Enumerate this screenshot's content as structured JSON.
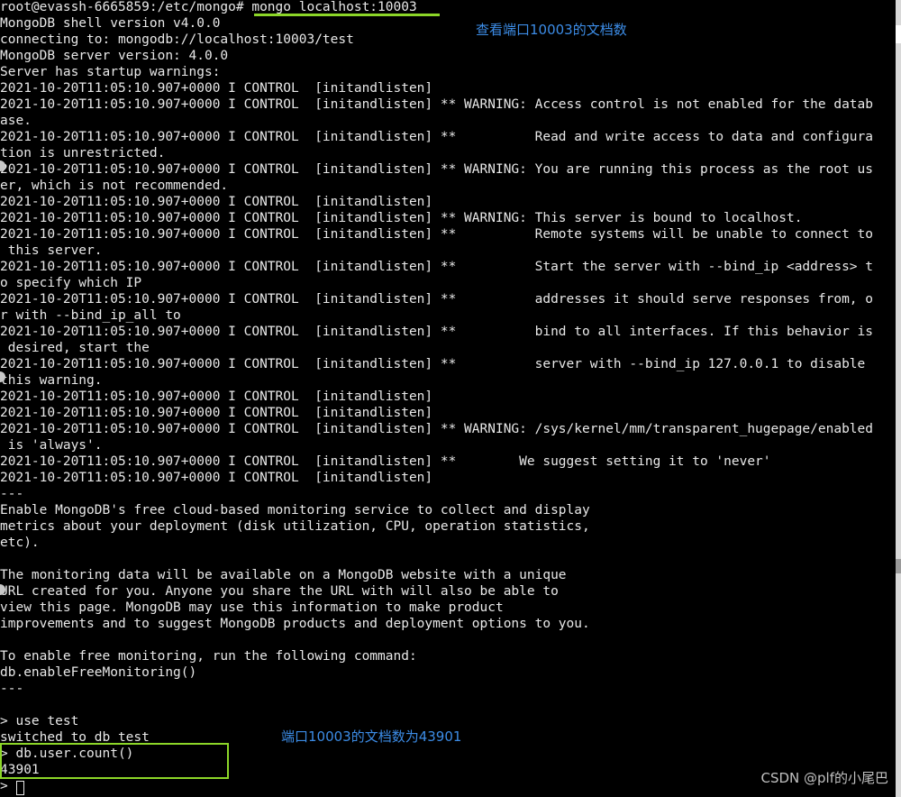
{
  "terminal": {
    "lines": [
      "root@evassh-6665859:/etc/mongo# mongo localhost:10003",
      "MongoDB shell version v4.0.0",
      "connecting to: mongodb://localhost:10003/test",
      "MongoDB server version: 4.0.0",
      "Server has startup warnings:",
      "2021-10-20T11:05:10.907+0000 I CONTROL  [initandlisten]",
      "2021-10-20T11:05:10.907+0000 I CONTROL  [initandlisten] ** WARNING: Access control is not enabled for the datab",
      "ase.",
      "2021-10-20T11:05:10.907+0000 I CONTROL  [initandlisten] **          Read and write access to data and configura",
      "tion is unrestricted.",
      "2021-10-20T11:05:10.907+0000 I CONTROL  [initandlisten] ** WARNING: You are running this process as the root us",
      "er, which is not recommended.",
      "2021-10-20T11:05:10.907+0000 I CONTROL  [initandlisten]",
      "2021-10-20T11:05:10.907+0000 I CONTROL  [initandlisten] ** WARNING: This server is bound to localhost.",
      "2021-10-20T11:05:10.907+0000 I CONTROL  [initandlisten] **          Remote systems will be unable to connect to",
      " this server.",
      "2021-10-20T11:05:10.907+0000 I CONTROL  [initandlisten] **          Start the server with --bind_ip <address> t",
      "o specify which IP",
      "2021-10-20T11:05:10.907+0000 I CONTROL  [initandlisten] **          addresses it should serve responses from, o",
      "r with --bind_ip_all to",
      "2021-10-20T11:05:10.907+0000 I CONTROL  [initandlisten] **          bind to all interfaces. If this behavior is",
      " desired, start the",
      "2021-10-20T11:05:10.907+0000 I CONTROL  [initandlisten] **          server with --bind_ip 127.0.0.1 to disable",
      "this warning.",
      "2021-10-20T11:05:10.907+0000 I CONTROL  [initandlisten]",
      "2021-10-20T11:05:10.907+0000 I CONTROL  [initandlisten]",
      "2021-10-20T11:05:10.907+0000 I CONTROL  [initandlisten] ** WARNING: /sys/kernel/mm/transparent_hugepage/enabled",
      " is 'always'.",
      "2021-10-20T11:05:10.907+0000 I CONTROL  [initandlisten] **        We suggest setting it to 'never'",
      "2021-10-20T11:05:10.907+0000 I CONTROL  [initandlisten]",
      "---",
      "Enable MongoDB's free cloud-based monitoring service to collect and display",
      "metrics about your deployment (disk utilization, CPU, operation statistics,",
      "etc).",
      "",
      "The monitoring data will be available on a MongoDB website with a unique",
      "URL created for you. Anyone you share the URL with will also be able to",
      "view this page. MongoDB may use this information to make product",
      "improvements and to suggest MongoDB products and deployment options to you.",
      "",
      "To enable free monitoring, run the following command:",
      "db.enableFreeMonitoring()",
      "---",
      "",
      "> use test",
      "switched to db test",
      "> db.user.count()",
      "43901",
      "> "
    ]
  },
  "annotations": {
    "top_note": "查看端口10003的文档数",
    "bottom_note": "端口10003的文档数为43901"
  },
  "watermark": "CSDN @plf的小尾巴",
  "colors": {
    "background": "#000000",
    "text": "#e8e8e8",
    "annotation_green": "#8cd628",
    "annotation_blue": "#3c8ce6"
  }
}
